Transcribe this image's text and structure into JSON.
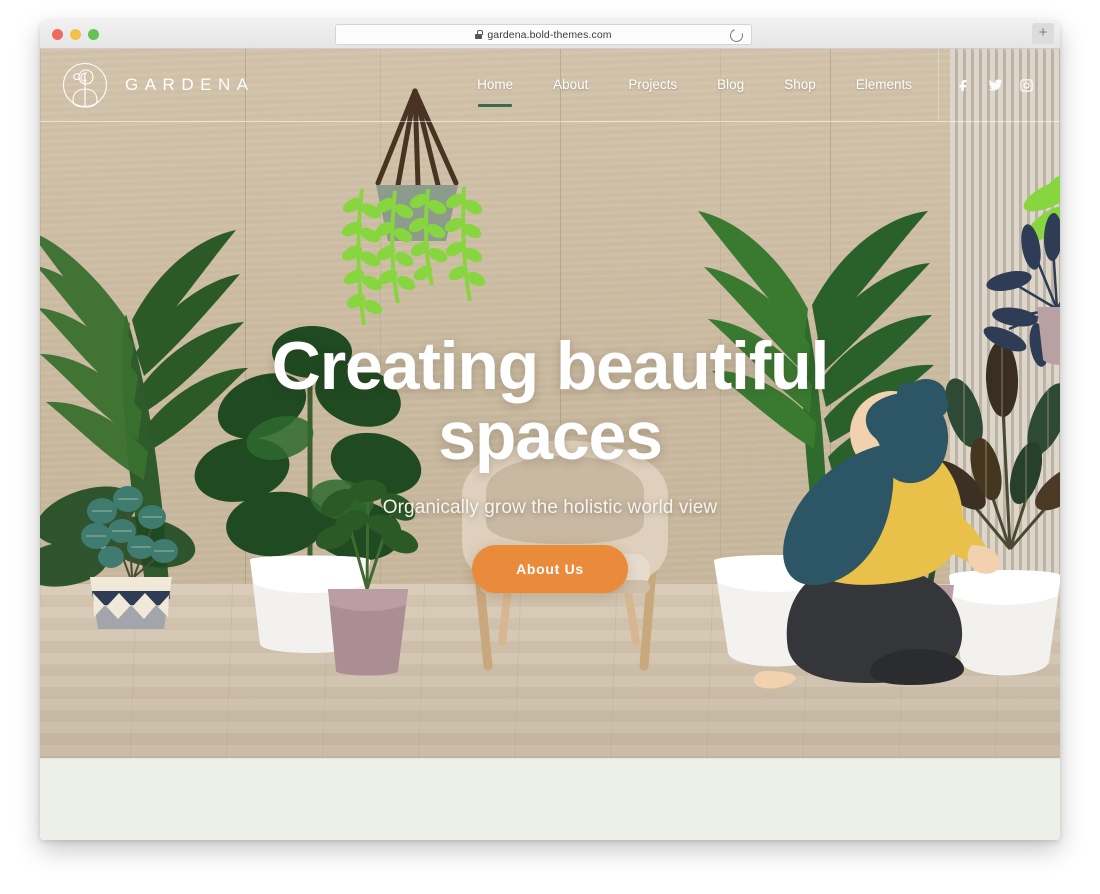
{
  "browser": {
    "url": "gardena.bold-themes.com",
    "lock_icon": "lock-icon",
    "reload_icon": "reload-icon",
    "new_tab_label": "+",
    "traffic_lights": [
      "close",
      "minimize",
      "zoom"
    ]
  },
  "site": {
    "brand_name": "GARDENA",
    "logo_icon": "rose-circle-logo-icon",
    "nav": [
      {
        "label": "Home",
        "active": true
      },
      {
        "label": "About",
        "active": false
      },
      {
        "label": "Projects",
        "active": false
      },
      {
        "label": "Blog",
        "active": false
      },
      {
        "label": "Shop",
        "active": false
      },
      {
        "label": "Elements",
        "active": false
      }
    ],
    "social": [
      {
        "name": "facebook-icon",
        "label": "Facebook"
      },
      {
        "name": "twitter-icon",
        "label": "Twitter"
      },
      {
        "name": "instagram-icon",
        "label": "Instagram"
      }
    ],
    "hero": {
      "title_line1": "Creating beautiful",
      "title_line2": "spaces",
      "subtitle": "Organically grow the holistic world view",
      "cta_label": "About Us"
    }
  },
  "colors": {
    "accent_orange": "#ea8b3c",
    "active_underline_green": "#3b6b4e",
    "bottom_panel": "#edf0e9",
    "hero_text": "#ffffff",
    "illustration_teal": "#2c5566",
    "illustration_yellow": "#e8c04a",
    "illustration_lime": "#8bd64a",
    "illustration_navy": "#2e3c55"
  }
}
